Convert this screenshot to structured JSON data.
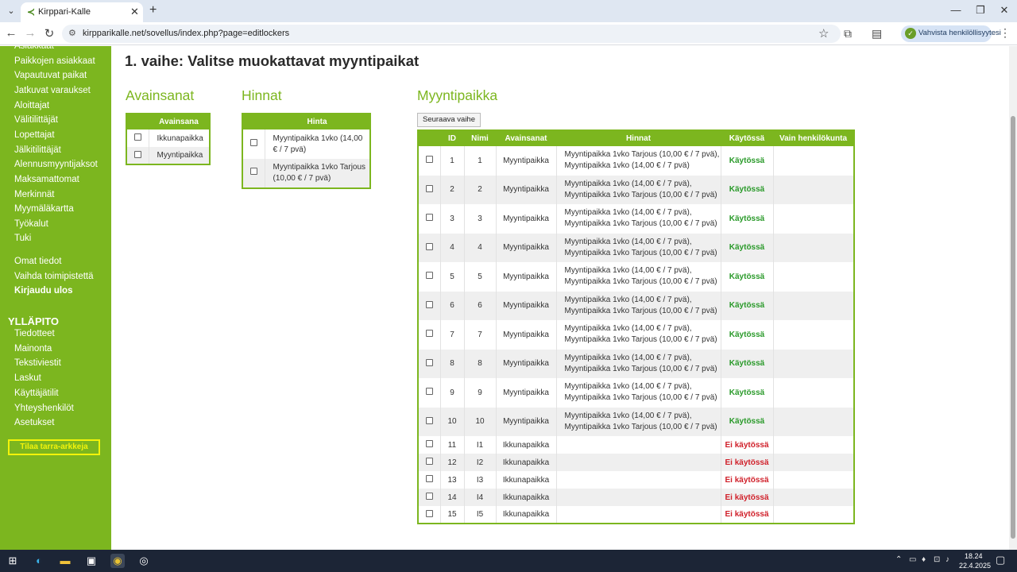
{
  "browser": {
    "tab_title": "Kirppari-Kalle",
    "url": "kirpparikalle.net/sovellus/index.php?page=editlockers",
    "verify_label": "Vahvista henkilöllisyytesi"
  },
  "sidebar": {
    "items_top": [
      {
        "label": "Asiakkaat"
      },
      {
        "label": "Paikkojen asiakkaat"
      },
      {
        "label": "Vapautuvat paikat"
      },
      {
        "label": "Jatkuvat varaukset"
      },
      {
        "label": "Aloittajat"
      },
      {
        "label": "Välitilittäjät"
      },
      {
        "label": "Lopettajat"
      },
      {
        "label": "Jälkitilittäjät"
      },
      {
        "label": "Alennusmyyntijaksot"
      },
      {
        "label": "Maksamattomat"
      },
      {
        "label": "Merkinnät"
      },
      {
        "label": "Myymäläkartta"
      },
      {
        "label": "Työkalut"
      },
      {
        "label": "Tuki"
      }
    ],
    "items_account": [
      {
        "label": "Omat tiedot"
      },
      {
        "label": "Vaihda toimipistettä"
      },
      {
        "label": "Kirjaudu ulos"
      }
    ],
    "admin_heading": "YLLÄPITO",
    "items_admin": [
      {
        "label": "Tiedotteet"
      },
      {
        "label": "Mainonta"
      },
      {
        "label": "Tekstiviestit"
      },
      {
        "label": "Laskut"
      },
      {
        "label": "Käyttäjätilit"
      },
      {
        "label": "Yhteyshenkilöt"
      },
      {
        "label": "Asetukset"
      }
    ],
    "sticker_button": "Tilaa tarra-arkkeja"
  },
  "main": {
    "title": "1. vaihe: Valitse muokattavat myyntipaikat",
    "keywords_title": "Avainsanat",
    "keywords_header": "Avainsana",
    "keywords": [
      "Ikkunapaikka",
      "Myyntipaikka"
    ],
    "prices_title": "Hinnat",
    "prices_header": "Hinta",
    "prices": [
      "Myyntipaikka 1vko (14,00 € / 7 pvä)",
      "Myyntipaikka 1vko Tarjous (10,00 € / 7 pvä)"
    ],
    "lockers_title": "Myyntipaikka",
    "next_button": "Seuraava vaihe",
    "columns": [
      "ID",
      "Nimi",
      "Avainsanat",
      "Hinnat",
      "Käytössä",
      "Vain henkilökunta"
    ],
    "rows": [
      {
        "id": "1",
        "name": "1",
        "keywords": "Myyntipaikka",
        "p1": "Myyntipaikka 1vko Tarjous (10,00 € / 7 pvä),",
        "p2": "Myyntipaikka 1vko (14,00 € / 7 pvä)",
        "status": "Käytössä"
      },
      {
        "id": "2",
        "name": "2",
        "keywords": "Myyntipaikka",
        "p1": "Myyntipaikka 1vko (14,00 € / 7 pvä),",
        "p2": "Myyntipaikka 1vko Tarjous (10,00 € / 7 pvä)",
        "status": "Käytössä"
      },
      {
        "id": "3",
        "name": "3",
        "keywords": "Myyntipaikka",
        "p1": "Myyntipaikka 1vko (14,00 € / 7 pvä),",
        "p2": "Myyntipaikka 1vko Tarjous (10,00 € / 7 pvä)",
        "status": "Käytössä"
      },
      {
        "id": "4",
        "name": "4",
        "keywords": "Myyntipaikka",
        "p1": "Myyntipaikka 1vko (14,00 € / 7 pvä),",
        "p2": "Myyntipaikka 1vko Tarjous (10,00 € / 7 pvä)",
        "status": "Käytössä"
      },
      {
        "id": "5",
        "name": "5",
        "keywords": "Myyntipaikka",
        "p1": "Myyntipaikka 1vko (14,00 € / 7 pvä),",
        "p2": "Myyntipaikka 1vko Tarjous (10,00 € / 7 pvä)",
        "status": "Käytössä"
      },
      {
        "id": "6",
        "name": "6",
        "keywords": "Myyntipaikka",
        "p1": "Myyntipaikka 1vko (14,00 € / 7 pvä),",
        "p2": "Myyntipaikka 1vko Tarjous (10,00 € / 7 pvä)",
        "status": "Käytössä"
      },
      {
        "id": "7",
        "name": "7",
        "keywords": "Myyntipaikka",
        "p1": "Myyntipaikka 1vko (14,00 € / 7 pvä),",
        "p2": "Myyntipaikka 1vko Tarjous (10,00 € / 7 pvä)",
        "status": "Käytössä"
      },
      {
        "id": "8",
        "name": "8",
        "keywords": "Myyntipaikka",
        "p1": "Myyntipaikka 1vko (14,00 € / 7 pvä),",
        "p2": "Myyntipaikka 1vko Tarjous (10,00 € / 7 pvä)",
        "status": "Käytössä"
      },
      {
        "id": "9",
        "name": "9",
        "keywords": "Myyntipaikka",
        "p1": "Myyntipaikka 1vko (14,00 € / 7 pvä),",
        "p2": "Myyntipaikka 1vko Tarjous (10,00 € / 7 pvä)",
        "status": "Käytössä"
      },
      {
        "id": "10",
        "name": "10",
        "keywords": "Myyntipaikka",
        "p1": "Myyntipaikka 1vko (14,00 € / 7 pvä),",
        "p2": "Myyntipaikka 1vko Tarjous (10,00 € / 7 pvä)",
        "status": "Käytössä"
      },
      {
        "id": "11",
        "name": "I1",
        "keywords": "Ikkunapaikka",
        "p1": "",
        "p2": "",
        "status": "Ei käytössä"
      },
      {
        "id": "12",
        "name": "I2",
        "keywords": "Ikkunapaikka",
        "p1": "",
        "p2": "",
        "status": "Ei käytössä"
      },
      {
        "id": "13",
        "name": "I3",
        "keywords": "Ikkunapaikka",
        "p1": "",
        "p2": "",
        "status": "Ei käytössä"
      },
      {
        "id": "14",
        "name": "I4",
        "keywords": "Ikkunapaikka",
        "p1": "",
        "p2": "",
        "status": "Ei käytössä"
      },
      {
        "id": "15",
        "name": "I5",
        "keywords": "Ikkunapaikka",
        "p1": "",
        "p2": "",
        "status": "Ei käytössä"
      }
    ]
  },
  "taskbar": {
    "time": "18.24",
    "date": "22.4.2025"
  },
  "colors": {
    "brand_green": "#7cb61f",
    "status_on": "#2a9a2a",
    "status_off": "#d0202a",
    "sticker_yellow": "#f3f30a"
  }
}
